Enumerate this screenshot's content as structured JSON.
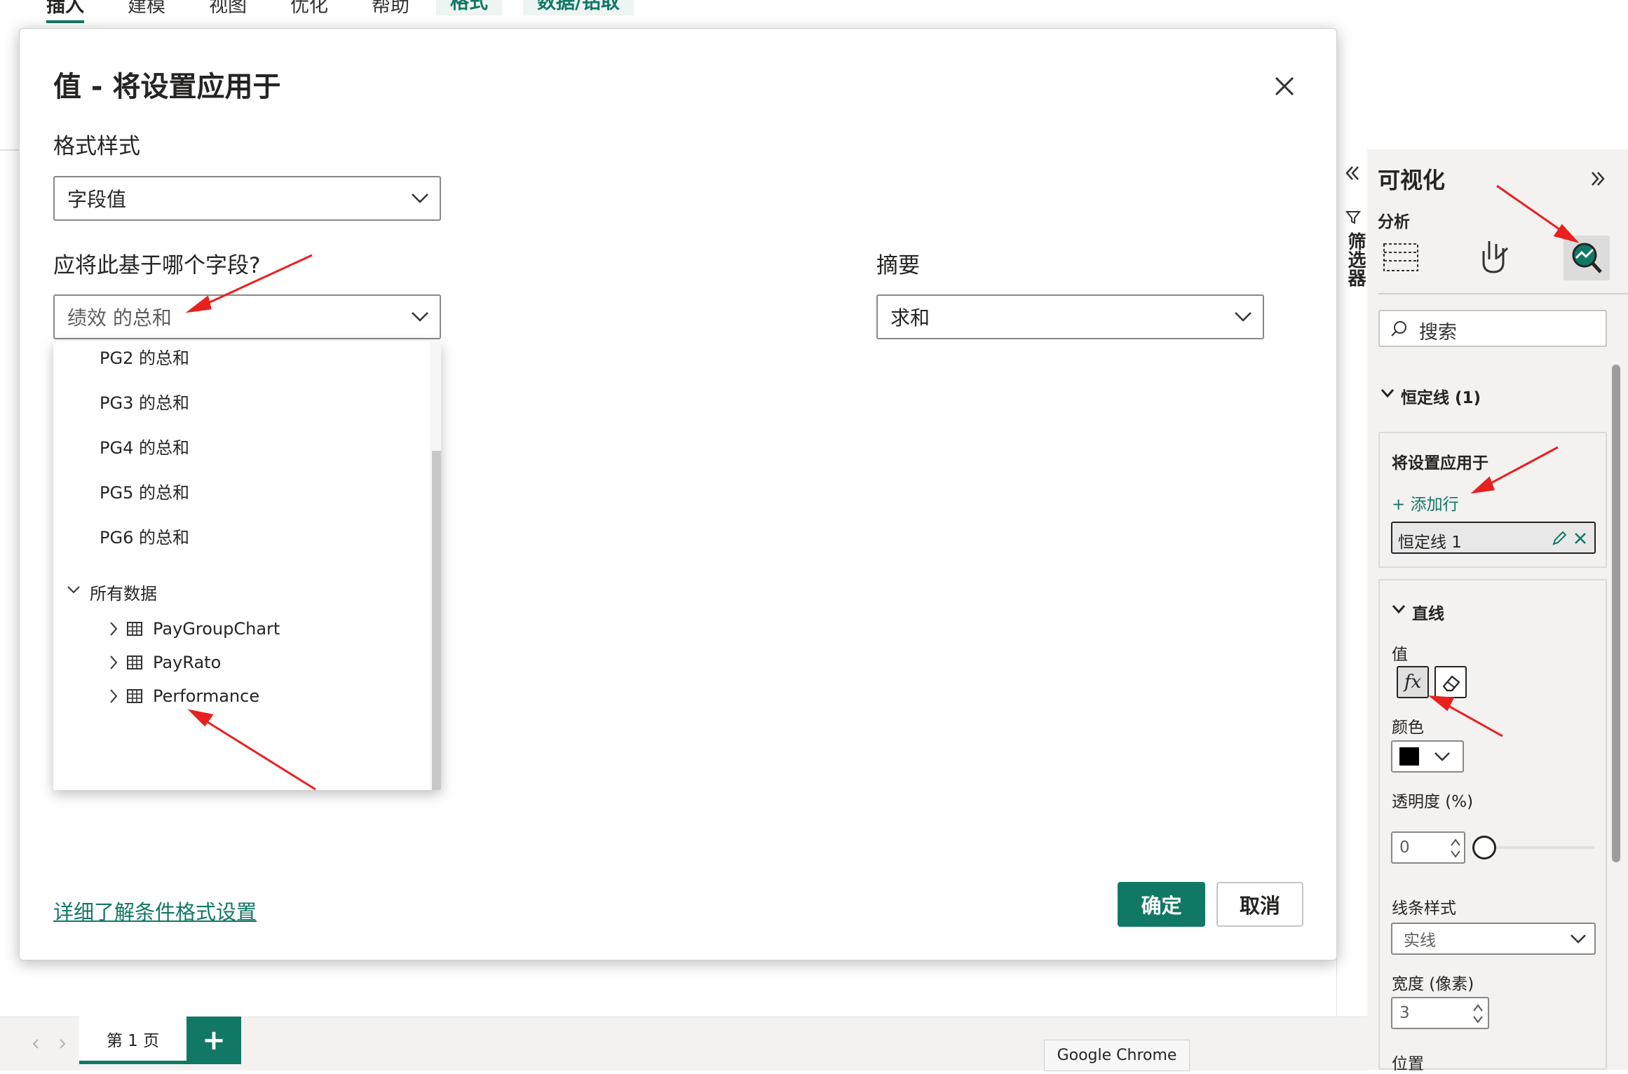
{
  "ribbon": {
    "tabs": [
      "插入",
      "建模",
      "视图",
      "优化",
      "帮助"
    ],
    "context_tabs": [
      "格式",
      "数据/钻取"
    ]
  },
  "dialog": {
    "title": "值 - 将设置应用于",
    "format_style_label": "格式样式",
    "format_style_value": "字段值",
    "field_label": "应将此基于哪个字段?",
    "field_value": "绩效 的总和",
    "summary_label": "摘要",
    "summary_value": "求和",
    "dropdown_items": [
      "PG2 的总和",
      "PG3 的总和",
      "PG4 的总和",
      "PG5 的总和",
      "PG6 的总和"
    ],
    "group_label": "所有数据",
    "tables": [
      "PayGroupChart",
      "PayRato",
      "Performance"
    ],
    "learn_more_link": "详细了解条件格式设置",
    "ok_button": "确定",
    "cancel_button": "取消"
  },
  "filters_pane": {
    "label": "筛选器"
  },
  "viz_pane": {
    "title": "可视化",
    "sub": "分析",
    "search_placeholder": "搜索",
    "section_constant_line": "恒定线 (1)",
    "apply_to_label": "将设置应用于",
    "add_row": "+ 添加行",
    "constant_line_item": "恒定线 1",
    "section_line": "直线",
    "value_label": "值",
    "fx_label": "fx",
    "color_label": "颜色",
    "color_value": "#000000",
    "transparency_label": "透明度 (%)",
    "transparency_value": "0",
    "line_style_label": "线条样式",
    "line_style_value": "实线",
    "width_label": "宽度 (像素)",
    "width_value": "3",
    "position_label": "位置"
  },
  "bottom": {
    "page_tab": "第 1 页",
    "add_page": "+",
    "tooltip": "Google Chrome"
  },
  "colors": {
    "accent": "#117865",
    "annotation_arrow": "#e8201e"
  }
}
